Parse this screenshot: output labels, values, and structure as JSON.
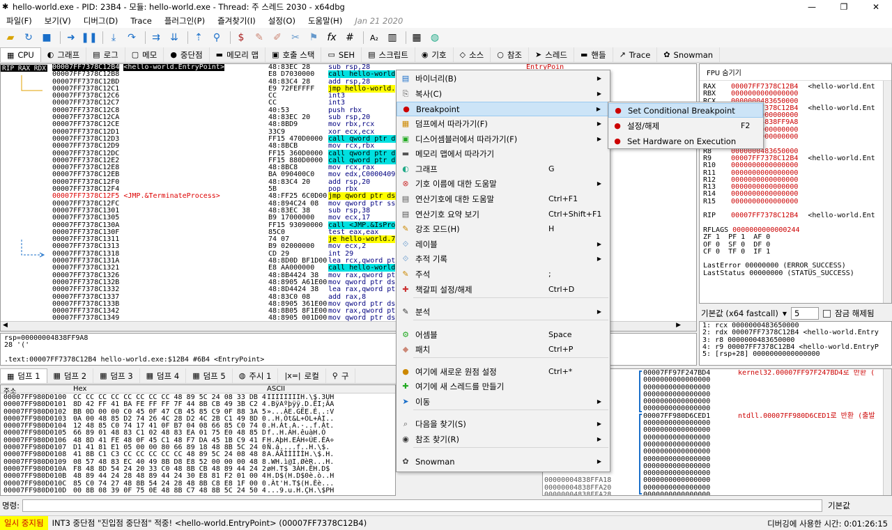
{
  "window": {
    "title": "hello-world.exe - PID: 23B4 - 모듈: hello-world.exe - Thread: 주 스레드 2030 - x64dbg"
  },
  "menubar": [
    "파일(F)",
    "보기(V)",
    "디버그(D)",
    "Trace",
    "플러그인(P)",
    "즐겨찾기(I)",
    "설정(O)",
    "도움말(H)"
  ],
  "menubar_date": "Jan 21 2020",
  "tabs": [
    {
      "icon": "▦",
      "label": "CPU"
    },
    {
      "icon": "◐",
      "label": "그래프"
    },
    {
      "icon": "▤",
      "label": "로그"
    },
    {
      "icon": "▢",
      "label": "메모"
    },
    {
      "icon": "●",
      "label": "중단점"
    },
    {
      "icon": "▬",
      "label": "메모리 맵"
    },
    {
      "icon": "▣",
      "label": "호출 스택"
    },
    {
      "icon": "▭",
      "label": "SEH"
    },
    {
      "icon": "▤",
      "label": "스크립트"
    },
    {
      "icon": "◉",
      "label": "기호"
    },
    {
      "icon": "◇",
      "label": "소스"
    },
    {
      "icon": "○",
      "label": "참조"
    },
    {
      "icon": "➤",
      "label": "스레드"
    },
    {
      "icon": "▬",
      "label": "핸들"
    },
    {
      "icon": "↗",
      "label": "Trace"
    },
    {
      "icon": "✿",
      "label": "Snowman"
    }
  ],
  "cpu": {
    "gutter_label": "RIP RAX RDX",
    "rows": [
      {
        "addr": "00007FF7378C12B4",
        "label": "<hello-world.EntryPoint>",
        "bytes": "48:83EC 28",
        "asm": "sub rsp,28",
        "cmt": "EntryPoin"
      },
      {
        "addr": "00007FF7378C12B8",
        "label": "",
        "bytes": "E8 D7030000",
        "asm": "call hello-world",
        "cmt": ""
      },
      {
        "addr": "00007FF7378C12BD",
        "label": "",
        "bytes": "48:83C4 28",
        "asm": "add rsp,28",
        "cmt": ""
      },
      {
        "addr": "00007FF7378C12C1",
        "label": "",
        "bytes": "E9 72FEFFFF",
        "asm": "jmp hello-world.",
        "cmt": ""
      },
      {
        "addr": "00007FF7378C12C6",
        "label": "",
        "bytes": "CC",
        "asm": "int3",
        "cmt": ""
      },
      {
        "addr": "00007FF7378C12C7",
        "label": "",
        "bytes": "CC",
        "asm": "int3",
        "cmt": ""
      },
      {
        "addr": "00007FF7378C12C8",
        "label": "",
        "bytes": "40:53",
        "asm": "push rbx",
        "cmt": ""
      },
      {
        "addr": "00007FF7378C12CA",
        "label": "",
        "bytes": "48:83EC 20",
        "asm": "sub rsp,20",
        "cmt": ""
      },
      {
        "addr": "00007FF7378C12CE",
        "label": "",
        "bytes": "48:8BD9",
        "asm": "mov rbx,rcx",
        "cmt": ""
      },
      {
        "addr": "00007FF7378C12D1",
        "label": "",
        "bytes": "33C9",
        "asm": "xor ecx,ecx",
        "cmt": ""
      },
      {
        "addr": "00007FF7378C12D3",
        "label": "",
        "bytes": "FF15 470D0000",
        "asm": "call qword ptr ds",
        "cmt": ""
      },
      {
        "addr": "00007FF7378C12D9",
        "label": "",
        "bytes": "48:8BCB",
        "asm": "mov rcx,rbx",
        "cmt": ""
      },
      {
        "addr": "00007FF7378C12DC",
        "label": "",
        "bytes": "FF15 360D0000",
        "asm": "call qword ptr ds",
        "cmt": ""
      },
      {
        "addr": "00007FF7378C12E2",
        "label": "",
        "bytes": "FF15 880D0000",
        "asm": "call qword ptr ds",
        "cmt": ""
      },
      {
        "addr": "00007FF7378C12E8",
        "label": "",
        "bytes": "48:8BC8",
        "asm": "mov rcx,rax",
        "cmt": ""
      },
      {
        "addr": "00007FF7378C12EB",
        "label": "",
        "bytes": "BA 090400C0",
        "asm": "mov edx,C0000409",
        "cmt": ""
      },
      {
        "addr": "00007FF7378C12F0",
        "label": "",
        "bytes": "48:83C4 20",
        "asm": "add rsp,20",
        "cmt": ""
      },
      {
        "addr": "00007FF7378C12F4",
        "label": "",
        "bytes": "5B",
        "asm": "pop rbx",
        "cmt": ""
      },
      {
        "addr": "00007FF7378C12F5",
        "label": "<JMP.&TerminateProcess>",
        "bytes": "48:FF25 6C0D00",
        "asm": "jmp qword ptr ds:",
        "cmt": ""
      },
      {
        "addr": "00007FF7378C12FC",
        "label": "",
        "bytes": "48:894C24 08",
        "asm": "mov qword ptr ss:",
        "cmt": ""
      },
      {
        "addr": "00007FF7378C1301",
        "label": "",
        "bytes": "48:83EC 38",
        "asm": "sub rsp,38",
        "cmt": ""
      },
      {
        "addr": "00007FF7378C1305",
        "label": "",
        "bytes": "B9 17000000",
        "asm": "mov ecx,17",
        "cmt": ""
      },
      {
        "addr": "00007FF7378C130A",
        "label": "",
        "bytes": "FF15 93090000",
        "asm": "call <JMP.&IsPro",
        "cmt": ""
      },
      {
        "addr": "00007FF7378C130F",
        "label": "",
        "bytes": "85C0",
        "asm": "test eax,eax",
        "cmt": ""
      },
      {
        "addr": "00007FF7378C1311",
        "label": "",
        "bytes": "74 07",
        "asm": "je hello-world.7",
        "cmt": ""
      },
      {
        "addr": "00007FF7378C1313",
        "label": "",
        "bytes": "B9 02000000",
        "asm": "mov ecx,2",
        "cmt": ""
      },
      {
        "addr": "00007FF7378C1318",
        "label": "",
        "bytes": "CD 29",
        "asm": "int 29",
        "cmt": ""
      },
      {
        "addr": "00007FF7378C131A",
        "label": "",
        "bytes": "48:8D0D BF1D00",
        "asm": "lea rcx,qword ptr",
        "cmt": ""
      },
      {
        "addr": "00007FF7378C1321",
        "label": "",
        "bytes": "E8 AA000000",
        "asm": "call hello-world",
        "cmt": ""
      },
      {
        "addr": "00007FF7378C1326",
        "label": "",
        "bytes": "48:8B4424 38",
        "asm": "mov rax,qword ptr",
        "cmt": ""
      },
      {
        "addr": "00007FF7378C132B",
        "label": "",
        "bytes": "48:8905 A61E00",
        "asm": "mov qword ptr ds:",
        "cmt": ""
      },
      {
        "addr": "00007FF7378C1332",
        "label": "",
        "bytes": "48:8D4424 38",
        "asm": "lea rax,qword ptr",
        "cmt": ""
      },
      {
        "addr": "00007FF7378C1337",
        "label": "",
        "bytes": "48:83C0 08",
        "asm": "add rax,8",
        "cmt": ""
      },
      {
        "addr": "00007FF7378C133B",
        "label": "",
        "bytes": "48:8905 361E00",
        "asm": "mov qword ptr ds:",
        "cmt": ""
      },
      {
        "addr": "00007FF7378C1342",
        "label": "",
        "bytes": "48:8B05 8F1E00",
        "asm": "mov rax,qword ptr",
        "cmt": ""
      },
      {
        "addr": "00007FF7378C1349",
        "label": "",
        "bytes": "48:8905 001D00",
        "asm": "mov qword ptr ds:",
        "cmt": ""
      }
    ]
  },
  "info": {
    "line1": "rsp=00000004838FF9A8",
    "line2": "28 '('",
    "line3": ".text:00007FF7378C12B4 hello-world.exe:$12B4 #6B4 <EntryPoint>"
  },
  "registers": {
    "header": "FPU 숨기기",
    "lines": [
      {
        "n": "RAX",
        "v": "00007FF7378C12B4",
        "c": "<hello-world.Ent"
      },
      {
        "n": "RBX",
        "v": "0000000000000000",
        "c": ""
      },
      {
        "n": "RCX",
        "v": "0000000483650000",
        "c": ""
      },
      {
        "n": "RDX",
        "v": "00007FF7378C12B4",
        "c": "<hello-world.Ent"
      },
      {
        "n": "RBP",
        "v": "0000000000000000",
        "c": ""
      },
      {
        "n": "RSP",
        "v": "00000004838FF9A8",
        "c": ""
      },
      {
        "n": "RSI",
        "v": "0000000000000000",
        "c": ""
      },
      {
        "n": "RDI",
        "v": "0000000000000000",
        "c": ""
      },
      {
        "n": "",
        "v": "",
        "c": ""
      },
      {
        "n": "R8",
        "v": "0000000483650000",
        "c": ""
      },
      {
        "n": "R9",
        "v": "00007FF7378C12B4",
        "c": "<hello-world.Ent"
      },
      {
        "n": "R10",
        "v": "0000000000000000",
        "c": ""
      },
      {
        "n": "R11",
        "v": "0000000000000000",
        "c": ""
      },
      {
        "n": "R12",
        "v": "0000000000000000",
        "c": ""
      },
      {
        "n": "R13",
        "v": "0000000000000000",
        "c": ""
      },
      {
        "n": "R14",
        "v": "0000000000000000",
        "c": ""
      },
      {
        "n": "R15",
        "v": "0000000000000000",
        "c": ""
      },
      {
        "n": "",
        "v": "",
        "c": ""
      },
      {
        "n": "RIP",
        "v": "00007FF7378C12B4",
        "c": "<hello-world.Ent"
      },
      {
        "n": "",
        "v": "",
        "c": ""
      },
      {
        "n": "RFLAGS",
        "v": "0000000000000244",
        "c": ""
      },
      {
        "n": "ZF 1  PF 1  AF 0",
        "v": "",
        "c": ""
      },
      {
        "n": "OF 0  SF 0  DF 0",
        "v": "",
        "c": ""
      },
      {
        "n": "CF 0  TF 0  IF 1",
        "v": "",
        "c": ""
      },
      {
        "n": "",
        "v": "",
        "c": ""
      },
      {
        "n": "LastError",
        "v": "00000000 (ERROR_SUCCESS)",
        "c": ""
      },
      {
        "n": "LastStatus",
        "v": "00000000 (STATUS_SUCCESS)",
        "c": ""
      }
    ]
  },
  "stackctl": {
    "callconv": "기본값 (x64 fastcall)",
    "count": "5",
    "lock_label": "잠금 해제됨"
  },
  "args": [
    "1: rcx 0000000483650000",
    "2: rdx 00007FF7378C12B4 <hello-world.Entry",
    "3: r8 0000000483650000",
    "4: r9 00007FF7378C12B4 <hello-world.EntryP",
    "5: [rsp+28] 0000000000000000"
  ],
  "dumptabs": [
    {
      "icon": "▦",
      "label": "덤프 1"
    },
    {
      "icon": "▦",
      "label": "덤프 2"
    },
    {
      "icon": "▦",
      "label": "덤프 3"
    },
    {
      "icon": "▦",
      "label": "덤프 4"
    },
    {
      "icon": "▦",
      "label": "덤프 5"
    },
    {
      "icon": "◍",
      "label": "주시 1"
    },
    {
      "icon": "|x=|",
      "label": "로컬"
    },
    {
      "icon": "⚲",
      "label": "구"
    }
  ],
  "dump": {
    "headers": {
      "addr": "주소",
      "hex": "Hex",
      "ascii": "ASCII"
    },
    "addr": [
      "00007FF980D0100",
      "00007FF980D0101",
      "00007FF980D0102",
      "00007FF980D0103",
      "00007FF980D0104",
      "00007FF980D0105",
      "00007FF980D0106",
      "00007FF980D0107",
      "00007FF980D0108",
      "00007FF980D0109",
      "00007FF980D010A",
      "00007FF980D010B",
      "00007FF980D010C",
      "00007FF980D010D"
    ],
    "hex": [
      "CC CC CC CC CC CC CC CC 48 89 5C 24 08 33 DB 48",
      "8D 42 FF 41 BA FE FF FF 7F 44 8B CB 49 3B C2 41",
      "BB 0D 00 00 C0 45 0F 47 CB 45 85 C9 0F 88 3A 56",
      "0A 00 48 85 D2 74 26 4C 28 D2 4C 2B C1 49 8D 04",
      "12 48 85 C0 74 17 41 0F B7 04 08 66 85 C0 74 0D",
      "66 89 01 48 83 C1 02 48 83 EA 01 75 E0 48 85 D2",
      "48 8D 41 FE 48 0F 45 C1 48 F7 DA 45 1B C9 41 F7",
      "D1 41 81 E1 05 00 00 80 66 89 18 48 8B 5C 24 08",
      "41 8B C1 C3 CC CC CC CC CC 48 89 5C 24 08 48 89",
      "08 57 48 83 EC 40 49 8B D8 E8 52 00 00 00 48 8B",
      "F8 48 8D 54 24 20 33 C0 48 8B CB 48 89 44 24 20",
      "48 89 44 24 28 48 89 44 24 30 E8 81 F2 01 00 48",
      "85 C0 74 27 48 8B 54 24 28 48 8B C8 E8 1F 00 00",
      "00 8B 08 39 0F 75 0E 48 8B C7 48 8B 5C 24 50 48"
    ],
    "ascii": [
      "ÌÌÌÌÌÌÌÌH.\\$.3ÛH",
      ".BÿAºþÿÿ.D.ËI;ÂA",
      "»...ÀE.GËE.É..:V",
      "..H.Òt&L+ÒL+ÁI..",
      ".H.Àt.A.·..f.Àt.",
      "f..H.ÁH.êuàH.Ò",
      "H.AþH.EÁH÷ÚE.ÉA÷",
      "Ñ.á....f..H.\\$.",
      "A.ÁÃÌÌÌÌÌH.\\$.H.",
      ".WH.ì@I.ØèR...H.",
      "øH.T$ 3ÀH.ËH.D$",
      "H.D$(H.D$0è.ò..H",
      ".Àt'H.T$(H.Èè...",
      "...9.u.H.ÇH.\\$PH"
    ]
  },
  "stack2": {
    "left": [
      "",
      "",
      "",
      "",
      "",
      "",
      "",
      "",
      "",
      "",
      "",
      "",
      "",
      "",
      "",
      "00000004838FFA18",
      "00000004838FFA20",
      "00000004838FFA28"
    ],
    "right": [
      "00007FF97F247BD4",
      "0000000000000000",
      "0000000000000000",
      "0000000000000000",
      "0000000000000000",
      "0000000000000000",
      "00007FF980D6CED1",
      "0000000000000000",
      "0000000000000000",
      "0000000000000000",
      "0000000000000000",
      "0000000000000000",
      "0000000000000000",
      "0000000000000000",
      "0000000000000000",
      "0000000000000000",
      "0000000000000000",
      "0000000000000000"
    ],
    "comments": [
      "kernel32.00007FF97F247BD4로 반환 (",
      "",
      "",
      "",
      "",
      "",
      "ntdll.00007FF980D6CED1로 반환 (출발"
    ]
  },
  "cmdbar": {
    "label": "명령:",
    "right": "기본값"
  },
  "statusbar": {
    "badge": "일시 중지됨",
    "message": "INT3 중단점 \"진입점 중단점\" 적중! <hello-world.EntryPoint> (00007FF7378C12B4)",
    "time": "디버깅에 사용한 시간: 0:01:26:15"
  },
  "ctxmenu": {
    "items": [
      {
        "icon": "▤",
        "label": "바이너리(B)",
        "shortcut": "",
        "arrow": true
      },
      {
        "icon": "⎘",
        "label": "복사(C)",
        "shortcut": "",
        "arrow": true
      },
      {
        "icon": "●",
        "label": "Breakpoint",
        "shortcut": "",
        "arrow": true
      },
      {
        "icon": "▦",
        "label": "덤프에서 따라가기(F)",
        "shortcut": "",
        "arrow": true
      },
      {
        "icon": "▣",
        "label": "디스어셈블러에서 따라가기(F)",
        "shortcut": "",
        "arrow": true
      },
      {
        "icon": "▬",
        "label": "메모리 맵에서 따라가기",
        "shortcut": "",
        "arrow": false
      },
      {
        "icon": "◐",
        "label": "그래프",
        "shortcut": "G",
        "arrow": false
      },
      {
        "icon": "⊗",
        "label": "기호 이름에 대한 도움말",
        "shortcut": "",
        "arrow": true
      },
      {
        "icon": "▤",
        "label": "연산기호에 대한 도움말",
        "shortcut": "Ctrl+F1",
        "arrow": false
      },
      {
        "icon": "▤",
        "label": "연산기호 요약 보기",
        "shortcut": "Ctrl+Shift+F1",
        "arrow": false
      },
      {
        "icon": "✎",
        "label": "강조 모드(H)",
        "shortcut": "H",
        "arrow": false
      },
      {
        "icon": "⟐",
        "label": "레이블",
        "shortcut": "",
        "arrow": true
      },
      {
        "icon": "⟐",
        "label": "추적 기록",
        "shortcut": "",
        "arrow": true
      },
      {
        "icon": "✎",
        "label": "주석",
        "shortcut": ";",
        "arrow": false
      },
      {
        "icon": "✚",
        "label": "책갈피 설정/해제",
        "shortcut": "Ctrl+D",
        "arrow": false
      },
      {
        "icon": "✎",
        "label": "분석",
        "shortcut": "",
        "arrow": true
      },
      {
        "icon": "⚙",
        "label": "어셈블",
        "shortcut": "Space",
        "arrow": false
      },
      {
        "icon": "◆",
        "label": "패치",
        "shortcut": "Ctrl+P",
        "arrow": false
      },
      {
        "icon": "●",
        "label": "여기에 새로운 원점 설정",
        "shortcut": "Ctrl+*",
        "arrow": false
      },
      {
        "icon": "✚",
        "label": "여기에 새 스레드를 만들기",
        "shortcut": "",
        "arrow": false
      },
      {
        "icon": "➤",
        "label": "이동",
        "shortcut": "",
        "arrow": true
      },
      {
        "icon": "⌕",
        "label": "다음을 찾기(S)",
        "shortcut": "",
        "arrow": true
      },
      {
        "icon": "◉",
        "label": "참조 찾기(R)",
        "shortcut": "",
        "arrow": true
      },
      {
        "icon": "✿",
        "label": "Snowman",
        "shortcut": "",
        "arrow": true
      }
    ]
  },
  "submenu": {
    "items": [
      {
        "icon": "●",
        "label": "Set Conditional Breakpoint",
        "shortcut": ""
      },
      {
        "icon": "●",
        "label": "설정/해제",
        "shortcut": "F2"
      },
      {
        "icon": "●",
        "label": "Set Hardware on Execution",
        "shortcut": ""
      }
    ]
  }
}
